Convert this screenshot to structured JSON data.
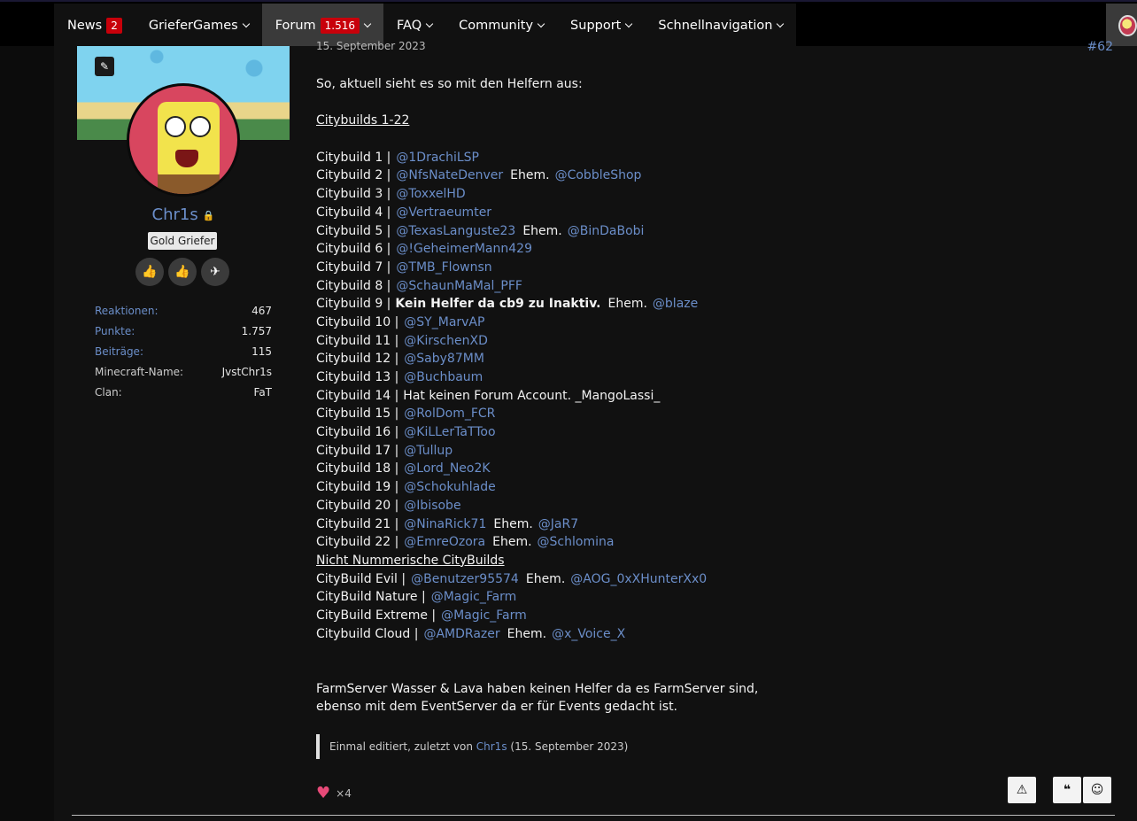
{
  "nav": {
    "items": [
      {
        "label": "News",
        "badge": "2"
      },
      {
        "label": "GrieferGames"
      },
      {
        "label": "Forum",
        "badge": "1.516"
      },
      {
        "label": "FAQ"
      },
      {
        "label": "Community"
      },
      {
        "label": "Support"
      },
      {
        "label": "Schnellnavigation"
      }
    ]
  },
  "user": {
    "name": "Chr1s",
    "rank": "Gold Griefer",
    "stats": [
      {
        "key": "Reaktionen:",
        "value": "467"
      },
      {
        "key": "Punkte:",
        "value": "1.757"
      },
      {
        "key": "Beiträge:",
        "value": "115"
      },
      {
        "key": "Minecraft-Name:",
        "value": "JvstChr1s"
      },
      {
        "key": "Clan:",
        "value": "FaT"
      }
    ]
  },
  "post": {
    "date": "15. September 2023",
    "number": "#62",
    "intro": "So, aktuell sieht es so mit den Helfern aus:",
    "section1_title": "Citybuilds 1-22",
    "lines": [
      {
        "prefix": "Citybuild 1 |",
        "mention": "@1DrachiLSP"
      },
      {
        "prefix": "Citybuild 2 |",
        "mention": "@NfsNateDenver",
        "ehem": "Ehem.",
        "mention2": "@CobbleShop"
      },
      {
        "prefix": "Citybuild 3 |",
        "mention": "@ToxxelHD"
      },
      {
        "prefix": "Citybuild 4 |",
        "mention": "@Vertraeumter"
      },
      {
        "prefix": "Citybuild 5 |",
        "mention": "@TexasLanguste23",
        "ehem": "Ehem.",
        "mention2": "@BinDaBobi"
      },
      {
        "prefix": "Citybuild 6 |",
        "mention": "@!GeheimerMann429"
      },
      {
        "prefix": "Citybuild 7 |",
        "mention": "@TMB_Flownsn"
      },
      {
        "prefix": "Citybuild 8 |",
        "mention": "@SchaunMaMal_PFF"
      },
      {
        "prefix": "Citybuild 9 |",
        "bold": "Kein Helfer da cb9 zu Inaktiv.",
        "ehem": "Ehem.",
        "mention2": "@blaze"
      },
      {
        "prefix": "Citybuild 10 |",
        "mention": "@SY_MarvAP"
      },
      {
        "prefix": "Citybuild 11 |",
        "mention": "@KirschenXD"
      },
      {
        "prefix": "Citybuild 12 |",
        "mention": "@Saby87MM"
      },
      {
        "prefix": "Citybuild 13 |",
        "mention": "@Buchbaum"
      },
      {
        "prefix": "Citybuild 14 |",
        "plain": "Hat keinen Forum Account. _MangoLassi_"
      },
      {
        "prefix": "Citybuild 15 |",
        "mention": "@RolDom_FCR"
      },
      {
        "prefix": "Citybuild 16 |",
        "mention": "@KiLLerTaTToo"
      },
      {
        "prefix": "Citybuild 17 |",
        "mention": "@Tullup"
      },
      {
        "prefix": "Citybuild 18 |",
        "mention": "@Lord_Neo2K"
      },
      {
        "prefix": "Citybuild 19 |",
        "mention": "@Schokuhlade"
      },
      {
        "prefix": "Citybuild 20 |",
        "mention": "@Ibisobe"
      },
      {
        "prefix": "Citybuild 21 |",
        "mention": "@NinaRick71",
        "ehem": "Ehem.",
        "mention2": "@JaR7"
      },
      {
        "prefix": "Citybuild 22 |",
        "mention": "@EmreOzora",
        "ehem": "Ehem.",
        "mention2": "@Schlomina"
      }
    ],
    "section2_title": "Nicht Nummerische CityBuilds",
    "lines2": [
      {
        "prefix": "CityBuild Evil |",
        "mention": "@Benutzer95574",
        "ehem": "Ehem.",
        "mention2": "@AOG_0xXHunterXx0"
      },
      {
        "prefix": "CityBuild Nature |",
        "mention": "@Magic_Farm"
      },
      {
        "prefix": "CityBuild Extreme |",
        "mention": "@Magic_Farm"
      },
      {
        "prefix": "Citybuild Cloud |",
        "mention": "@AMDRazer",
        "ehem": "Ehem.",
        "mention2": "@x_Voice_X"
      }
    ],
    "outro1": "FarmServer Wasser & Lava haben keinen Helfer da es FarmServer sind,",
    "outro2": "ebenso mit dem EventServer da er für Events gedacht ist.",
    "edit_note_prefix": "Einmal editiert, zuletzt von",
    "edit_note_user": "Chr1s",
    "edit_note_date": "(15. September 2023)",
    "reaction_count": "×4"
  },
  "colors": {
    "accent": "#6b8ec9",
    "badge": "#c8000a",
    "heart": "#e74a78"
  }
}
